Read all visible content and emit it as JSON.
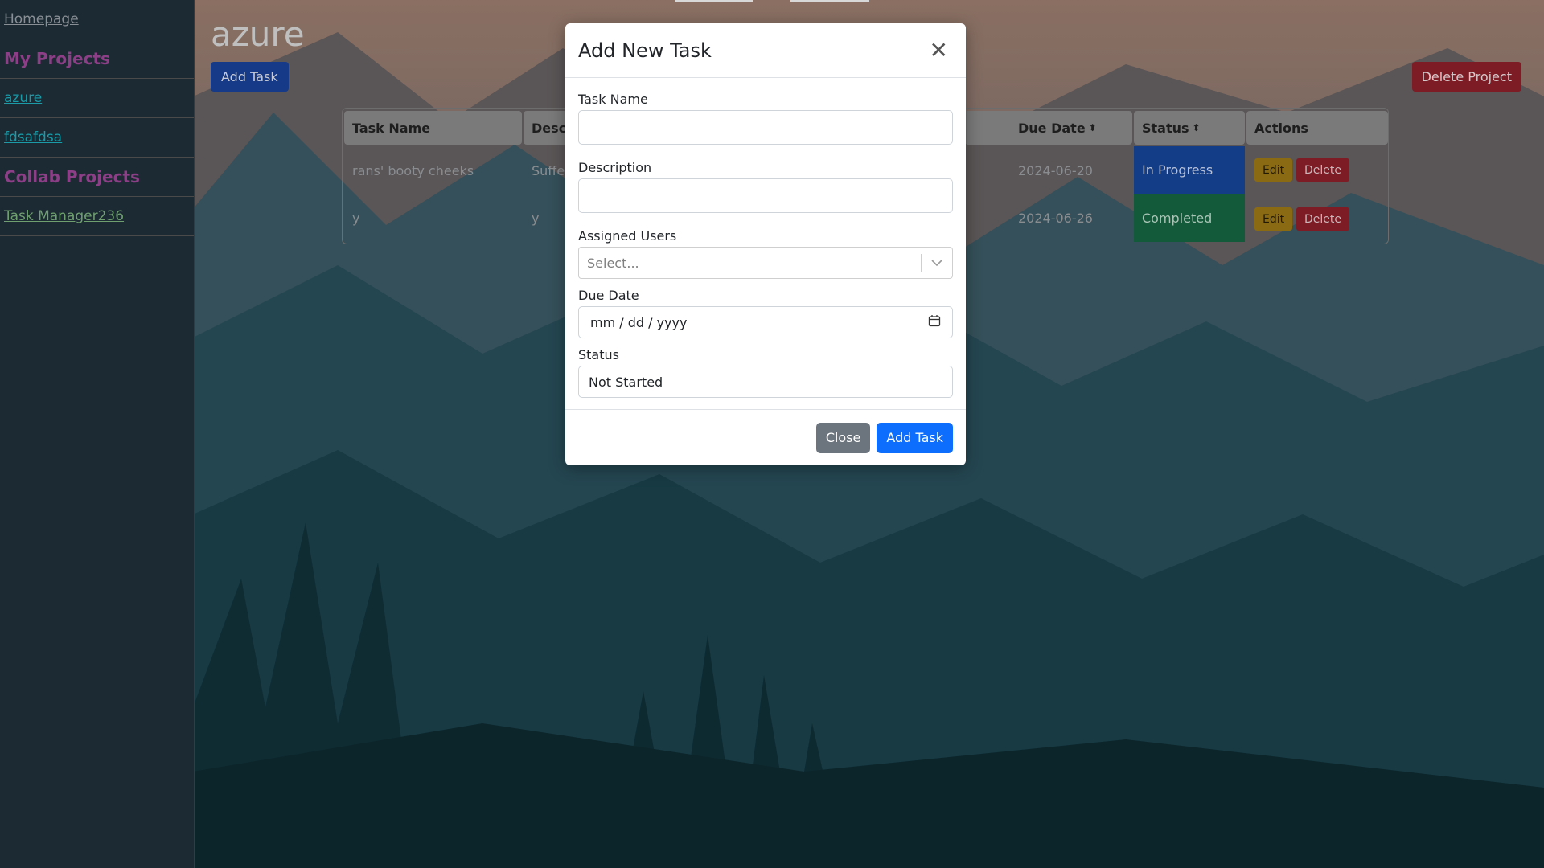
{
  "sidebar": {
    "homepage": "Homepage",
    "my_projects_heading": "My Projects",
    "my_projects": [
      "azure",
      "fdsafdsa"
    ],
    "collab_heading": "Collab Projects",
    "collab_projects": [
      "Task Manager236"
    ]
  },
  "project": {
    "title": "azure",
    "add_task_label": "Add Task",
    "delete_project_label": "Delete Project"
  },
  "table": {
    "headers": [
      "Task Name",
      "Descr",
      "Due Date",
      "Status",
      "Actions"
    ],
    "sort_glyph": "⬍",
    "rows": [
      {
        "name": "rans' booty cheeks",
        "description": "Suffe",
        "due": "2024-06-20",
        "status": "In Progress",
        "edit": "Edit",
        "delete": "Delete"
      },
      {
        "name": "y",
        "description": "y",
        "due": "2024-06-26",
        "status": "Completed",
        "edit": "Edit",
        "delete": "Delete"
      }
    ]
  },
  "modal": {
    "title": "Add New Task",
    "close_icon": "close-icon",
    "fields": {
      "task_name_label": "Task Name",
      "task_name_value": "",
      "description_label": "Description",
      "description_value": "",
      "assigned_users_label": "Assigned Users",
      "assigned_users_placeholder": "Select...",
      "due_date_label": "Due Date",
      "due_date_placeholder": "mm / dd / yyyy",
      "status_label": "Status",
      "status_value": "Not Started"
    },
    "close_button": "Close",
    "add_button": "Add Task"
  },
  "colors": {
    "accent": "#0d6efd",
    "secondary": "#6c757d",
    "danger": "#7e1c25",
    "warning": "#8a6a12",
    "in_progress": "#143d87",
    "completed": "#135a3a",
    "sidebar_heading": "#8c3f86"
  }
}
